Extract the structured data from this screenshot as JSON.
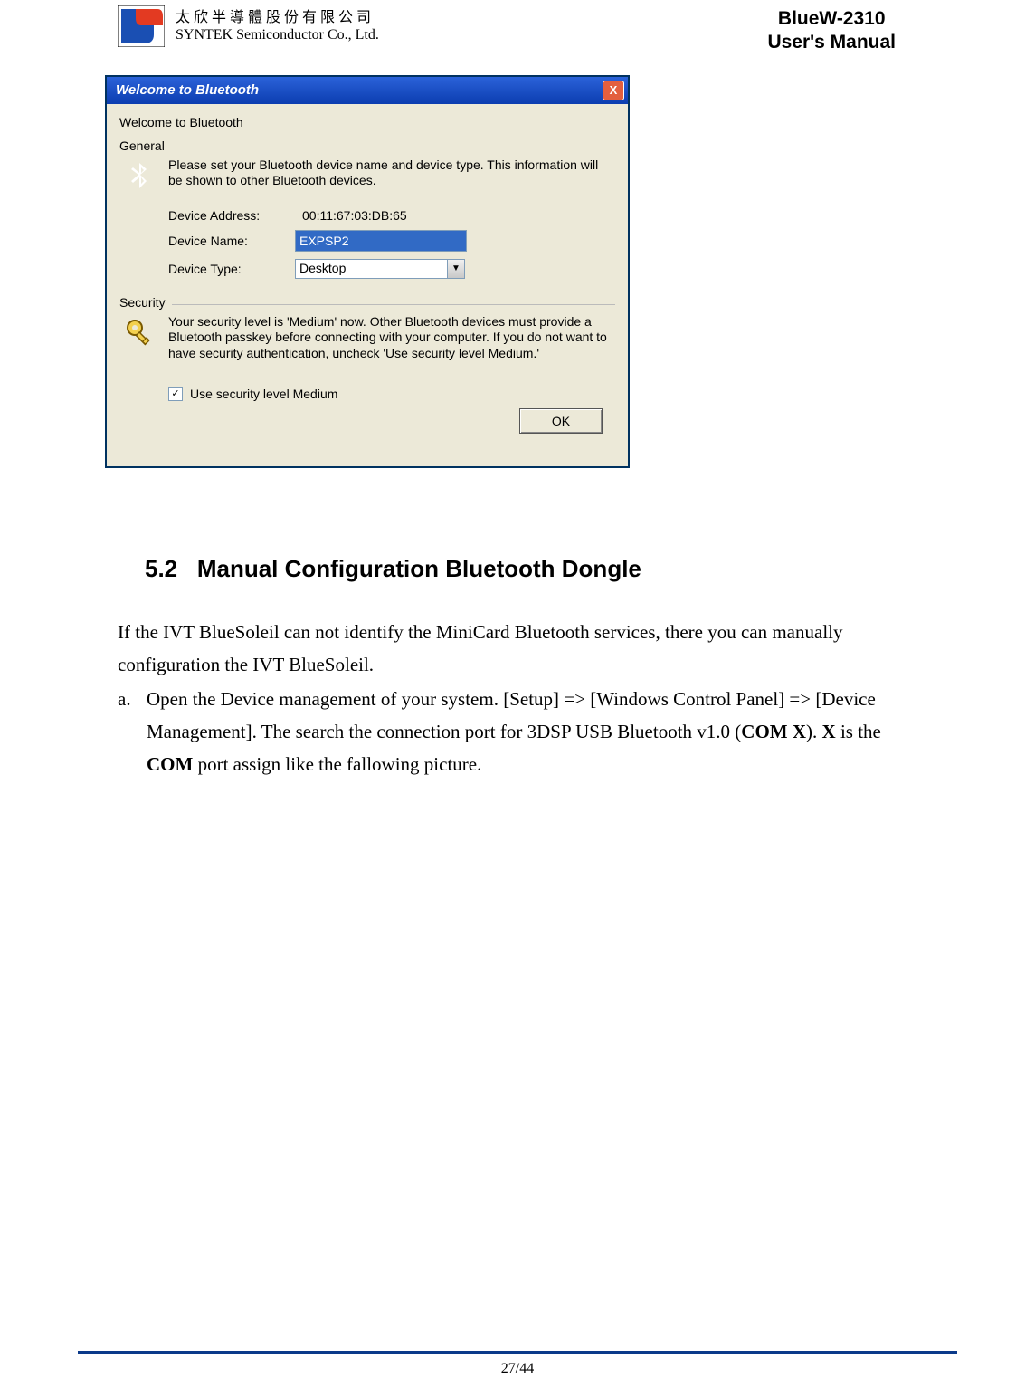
{
  "header": {
    "company_cn": "太 欣 半 導 體 股 份 有 限 公 司",
    "company_en": "SYNTEK Semiconductor Co., Ltd.",
    "product": "BlueW-2310",
    "doc_title": "User's Manual"
  },
  "dialog": {
    "title": "Welcome to Bluetooth",
    "heading": "Welcome to Bluetooth",
    "general_label": "General",
    "general_desc": "Please set your Bluetooth device name and device type. This information will be shown to other Bluetooth devices.",
    "field_address_label": "Device Address:",
    "field_address_value": "00:11:67:03:DB:65",
    "field_name_label": "Device Name:",
    "field_name_value": "EXPSP2",
    "field_type_label": "Device Type:",
    "field_type_value": "Desktop",
    "security_label": "Security",
    "security_desc": "Your security level is 'Medium' now. Other Bluetooth devices must provide a Bluetooth passkey before connecting with your computer. If you do not want to have security authentication, uncheck 'Use security level Medium.'",
    "checkbox_label": "Use security level Medium",
    "checkbox_checked": "✓",
    "ok_label": "OK",
    "close_label": "X"
  },
  "section": {
    "number": "5.2",
    "title": "Manual Configuration Bluetooth Dongle",
    "para": "If the IVT BlueSoleil can not identify the MiniCard Bluetooth services, there you can manually configuration the IVT BlueSoleil.",
    "item_a_marker": "a.",
    "item_a_pre": "Open the Device management of your system. [Setup] => [Windows Control Panel] => [Device Management]. The search the connection port for 3DSP USB Bluetooth v1.0 (",
    "item_a_bold1": "COM X",
    "item_a_mid": "). ",
    "item_a_bold2": "X",
    "item_a_mid2": " is the ",
    "item_a_bold3": "COM",
    "item_a_post": " port assign like the fallowing picture."
  },
  "footer": {
    "page": "27/44"
  }
}
